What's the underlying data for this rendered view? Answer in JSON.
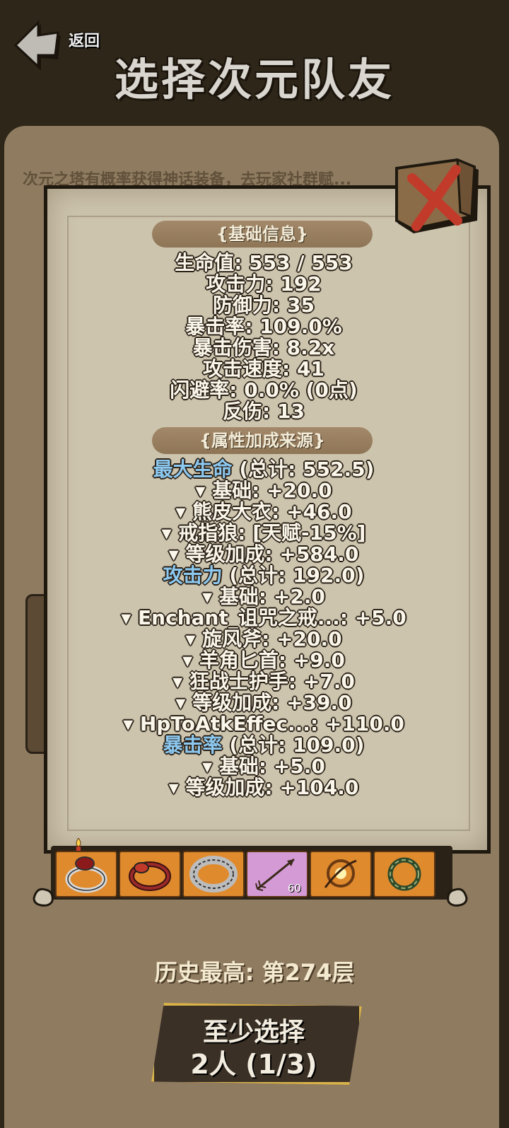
{
  "header": {
    "back_label": "返回",
    "title": "选择次元队友"
  },
  "board": {
    "intro_text": "次元之塔有概率获得神话装备，去玩家社群赋..."
  },
  "basic_info": {
    "header": "{基础信息}",
    "stats": [
      "生命值: 553 / 553",
      "攻击力: 192",
      "防御力: 35",
      "暴击率: 109.0%",
      "暴击伤害: 8.2x",
      "攻击速度: 41",
      "闪避率: 0.0% (0点)",
      "反伤: 13"
    ]
  },
  "sources": {
    "header": "{属性加成来源}",
    "groups": [
      {
        "name": "最大生命",
        "total": " (总计: 552.5)",
        "items": [
          "▾ 基础: +20.0",
          "▾ 熊皮大衣: +46.0",
          "▾ 戒指狼: [天赋-15%]",
          "▾ 等级加成: +584.0"
        ]
      },
      {
        "name": "攻击力",
        "total": " (总计: 192.0)",
        "items": [
          "▾ 基础: +2.0",
          "▾ Enchant_诅咒之戒...: +5.0",
          "▾ 旋风斧: +20.0",
          "▾ 羊角匕首: +9.0",
          "▾ 狂战士护手: +7.0",
          "▾ 等级加成: +39.0",
          "▾ HpToAtkEffec...: +110.0"
        ]
      },
      {
        "name": "暴击率",
        "total": " (总计: 109.0)",
        "items": [
          "▾ 基础: +5.0",
          "▾ 等级加成: +104.0"
        ]
      }
    ]
  },
  "equipment": {
    "slots": [
      {
        "icon": "ruby-ring-icon",
        "count": ""
      },
      {
        "icon": "red-gem-ring-icon",
        "count": ""
      },
      {
        "icon": "silver-band-ring-icon",
        "count": ""
      },
      {
        "icon": "arrow-icon",
        "count": "60"
      },
      {
        "icon": "flame-amulet-icon",
        "count": ""
      },
      {
        "icon": "thorn-wreath-icon",
        "count": ""
      }
    ]
  },
  "best_record": "历史最高: 第274层",
  "select_button": {
    "line1": "至少选择",
    "line2": "2人 (1/3)"
  },
  "colors": {
    "background": "#2e2618",
    "board": "#8f7b60",
    "parchment": "#cdc4ae",
    "highlight_blue": "#8cc8f0",
    "slot_orange": "#e08a2e",
    "slot_pink": "#d49ad6",
    "button_gold_border": "#d9b24a"
  }
}
